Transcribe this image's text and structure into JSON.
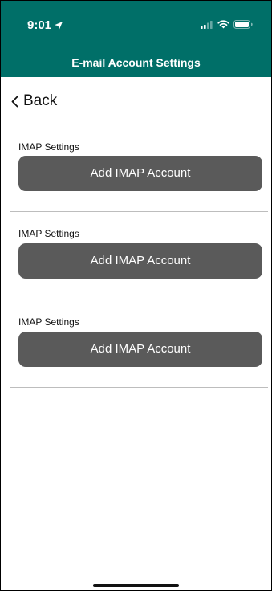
{
  "status_bar": {
    "time": "9:01",
    "icons": [
      "location-arrow-icon",
      "signal-icon",
      "wifi-icon",
      "battery-icon"
    ]
  },
  "nav": {
    "title": "E-mail Account Settings",
    "back_label": "Back"
  },
  "sections": [
    {
      "label": "IMAP Settings",
      "button_label": "Add IMAP Account"
    },
    {
      "label": "IMAP Settings",
      "button_label": "Add IMAP Account"
    },
    {
      "label": "IMAP Settings",
      "button_label": "Add IMAP Account"
    }
  ],
  "colors": {
    "header": "#006f68",
    "button": "#5a5a5a",
    "divider": "#bdbdbd"
  }
}
